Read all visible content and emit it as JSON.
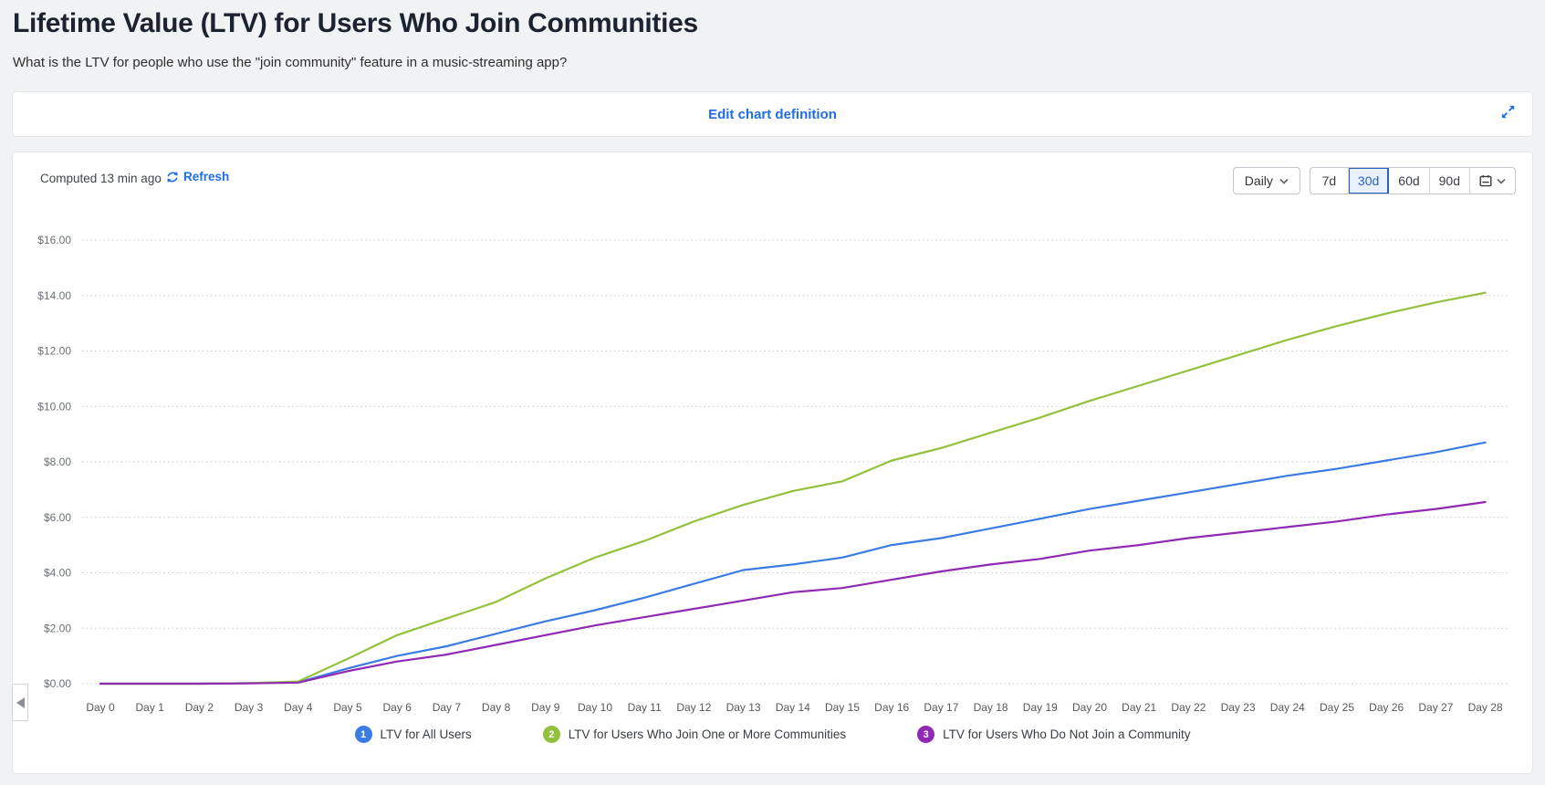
{
  "page": {
    "title": "Lifetime Value (LTV) for Users Who Join Communities",
    "subtitle": "What is the LTV for people who use the \"join community\" feature in a music-streaming app?"
  },
  "toolbar": {
    "edit_link": "Edit chart definition"
  },
  "chart_header": {
    "computed": "Computed 13 min ago",
    "refresh_label": "Refresh",
    "granularity": "Daily",
    "ranges": [
      "7d",
      "30d",
      "60d",
      "90d"
    ],
    "selected_range": "30d"
  },
  "colors": {
    "link_blue": "#1f6de8",
    "selected_range_blue": "#2a62c2",
    "selected_range_bg": "#e8f1fd",
    "grid": "#bfc9d4",
    "axis_text": "#6b7077",
    "series_blue": "#3b7ce2",
    "series_green": "#93c13d",
    "series_purple": "#9029b4"
  },
  "chart_data": {
    "type": "line",
    "title": "Lifetime Value (LTV) for Users Who Join Communities",
    "x_labels": [
      "Day 0",
      "Day 1",
      "Day 2",
      "Day 3",
      "Day 4",
      "Day 5",
      "Day 6",
      "Day 7",
      "Day 8",
      "Day 9",
      "Day 10",
      "Day 11",
      "Day 12",
      "Day 13",
      "Day 14",
      "Day 15",
      "Day 16",
      "Day 17",
      "Day 18",
      "Day 19",
      "Day 20",
      "Day 21",
      "Day 22",
      "Day 23",
      "Day 24",
      "Day 25",
      "Day 26",
      "Day 27",
      "Day 28"
    ],
    "ylim": [
      0,
      16
    ],
    "y_tick_values": [
      16,
      14,
      12,
      10,
      8,
      6,
      4,
      2,
      0
    ],
    "y_tick_labels": [
      "$16.00",
      "$14.00",
      "$12.00",
      "$10.00",
      "$8.00",
      "$6.00",
      "$4.00",
      "$2.00",
      "$0.00"
    ],
    "grid": "dotted-horizontal",
    "legend_position": "bottom",
    "series": [
      {
        "name": "LTV for All Users",
        "badge": "1",
        "color": "#3b7ce2",
        "values": [
          0,
          0,
          0,
          0.02,
          0.05,
          0.55,
          1.0,
          1.35,
          1.8,
          2.25,
          2.65,
          3.1,
          3.6,
          4.1,
          4.3,
          4.55,
          5.0,
          5.25,
          5.6,
          5.95,
          6.3,
          6.6,
          6.9,
          7.2,
          7.5,
          7.75,
          8.05,
          8.35,
          8.7
        ]
      },
      {
        "name": "LTV for Users Who Join One or More Communities",
        "badge": "2",
        "color": "#93c13d",
        "values": [
          0,
          0,
          0,
          0.02,
          0.08,
          0.9,
          1.75,
          2.35,
          2.95,
          3.8,
          4.55,
          5.15,
          5.85,
          6.45,
          6.95,
          7.3,
          8.05,
          8.5,
          9.05,
          9.6,
          10.2,
          10.75,
          11.3,
          11.85,
          12.4,
          12.9,
          13.35,
          13.75,
          14.1
        ]
      },
      {
        "name": "LTV for Users Who Do Not Join a Community",
        "badge": "3",
        "color": "#9029b4",
        "values": [
          0,
          0,
          0,
          0.01,
          0.04,
          0.45,
          0.8,
          1.05,
          1.4,
          1.75,
          2.1,
          2.4,
          2.7,
          3.0,
          3.3,
          3.45,
          3.75,
          4.05,
          4.3,
          4.5,
          4.8,
          5.0,
          5.25,
          5.45,
          5.65,
          5.85,
          6.1,
          6.3,
          6.55
        ]
      }
    ]
  }
}
